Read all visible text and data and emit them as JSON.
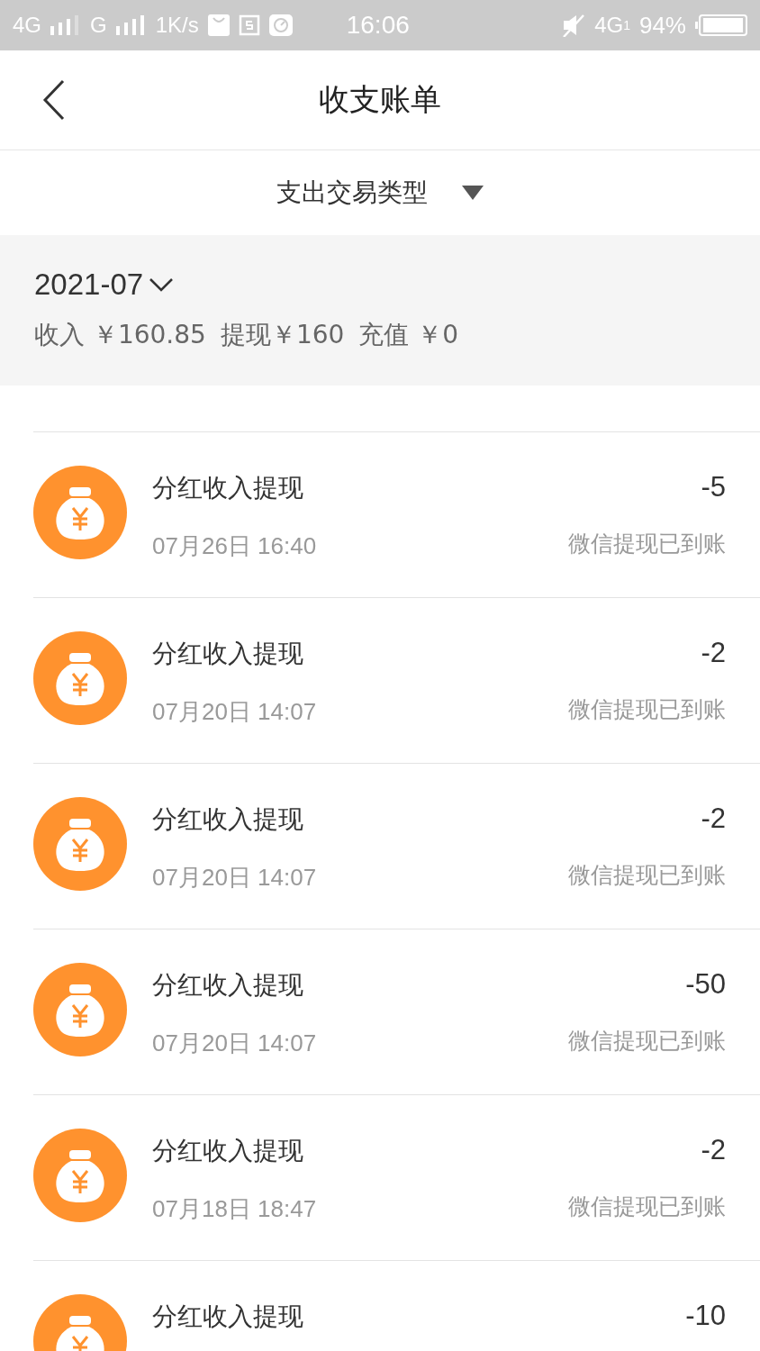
{
  "status_bar": {
    "network_1": "4G",
    "network_2": "G",
    "speed": "1K/s",
    "time": "16:06",
    "network_3": "4G",
    "sim": "1",
    "battery": "94%"
  },
  "header": {
    "title": "收支账单"
  },
  "filter": {
    "label": "支出交易类型"
  },
  "summary": {
    "month": "2021-07",
    "income_label": "收入",
    "income": "￥160.85",
    "withdraw_label": "提现",
    "withdraw": "￥160",
    "recharge_label": "充值",
    "recharge": "￥0"
  },
  "records": [
    {
      "title": "分红收入提现",
      "date": "07月26日 16:40",
      "amount": "-5",
      "status": "微信提现已到账"
    },
    {
      "title": "分红收入提现",
      "date": "07月20日 14:07",
      "amount": "-2",
      "status": "微信提现已到账"
    },
    {
      "title": "分红收入提现",
      "date": "07月20日 14:07",
      "amount": "-2",
      "status": "微信提现已到账"
    },
    {
      "title": "分红收入提现",
      "date": "07月20日 14:07",
      "amount": "-50",
      "status": "微信提现已到账"
    },
    {
      "title": "分红收入提现",
      "date": "07月18日 18:47",
      "amount": "-2",
      "status": "微信提现已到账"
    },
    {
      "title": "分红收入提现",
      "amount": "-10"
    }
  ]
}
